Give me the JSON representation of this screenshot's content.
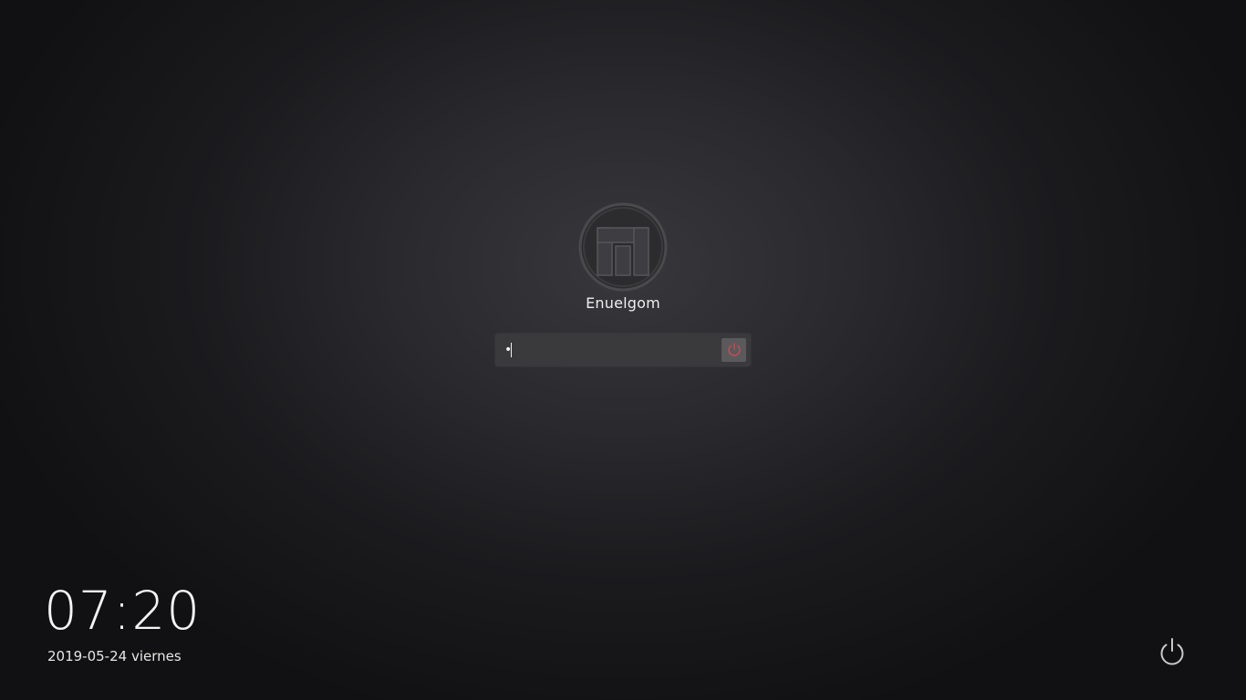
{
  "user": {
    "name": "Enuelgom",
    "avatar_icon": "manjaro-logo-icon"
  },
  "password": {
    "value": "•",
    "login_icon": "power-icon",
    "login_icon_color": "#e0464a"
  },
  "clock": {
    "time": "07:20",
    "date": "2019-05-24 viernes"
  },
  "power": {
    "icon": "power-icon"
  }
}
